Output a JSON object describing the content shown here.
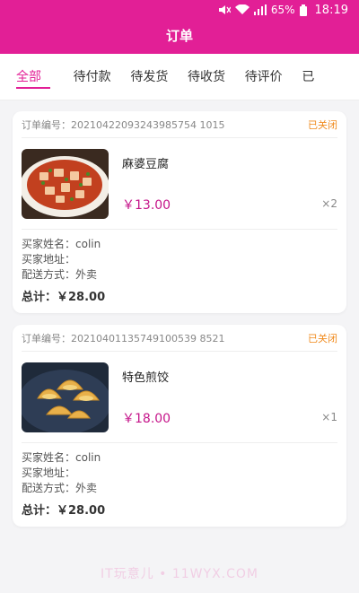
{
  "status_bar": {
    "battery": "65%",
    "time": "18:19"
  },
  "header": {
    "title": "订单"
  },
  "tabs": [
    {
      "label": "全部",
      "active": true
    },
    {
      "label": "待付款"
    },
    {
      "label": "待发货"
    },
    {
      "label": "待收货"
    },
    {
      "label": "待评价"
    },
    {
      "label": "已"
    }
  ],
  "orders": [
    {
      "order_no": "订单编号：20210422093243985754 1015",
      "status": "已关闭",
      "goods_name": "麻婆豆腐",
      "price": "￥13.00",
      "qty": "×2",
      "buyer_name": "买家姓名：colin",
      "buyer_address": "买家地址：",
      "delivery": "配送方式：外卖",
      "total": "总计：￥28.00"
    },
    {
      "order_no": "订单编号：20210401135749100539 8521",
      "status": "已关闭",
      "goods_name": "特色煎饺",
      "price": "￥18.00",
      "qty": "×1",
      "buyer_name": "买家姓名：colin",
      "buyer_address": "买家地址：",
      "delivery": "配送方式：外卖",
      "total": "总计：￥28.00"
    }
  ],
  "watermark": "IT玩意儿 • 11WYX.COM",
  "colors": {
    "brand": "#e21f96",
    "price": "#c5158a",
    "status": "#f08a1c"
  }
}
